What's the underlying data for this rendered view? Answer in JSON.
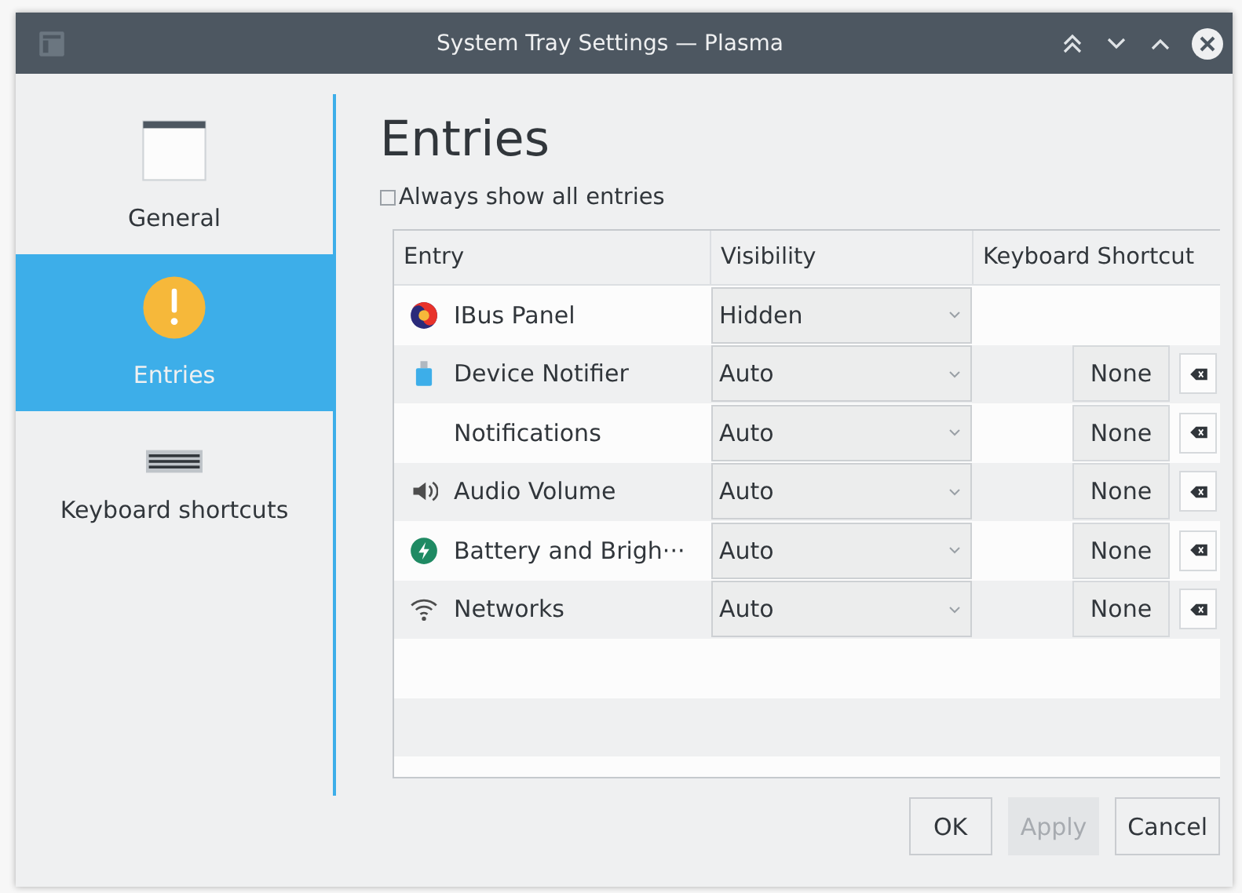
{
  "window": {
    "title": "System Tray Settings — Plasma"
  },
  "sidebar": {
    "items": [
      {
        "label": "General",
        "selected": false
      },
      {
        "label": "Entries",
        "selected": true
      },
      {
        "label": "Keyboard shortcuts",
        "selected": false
      }
    ]
  },
  "heading": "Entries",
  "always_show": {
    "label": "Always show all entries",
    "checked": false
  },
  "table": {
    "columns": [
      "Entry",
      "Visibility",
      "Keyboard Shortcut"
    ],
    "rows": [
      {
        "name": "IBus Panel",
        "visibility": "Hidden"
      },
      {
        "name": "Device Notifier",
        "visibility": "Auto",
        "shortcut": "None"
      },
      {
        "name": "Notifications",
        "visibility": "Auto",
        "shortcut": "None"
      },
      {
        "name": "Audio Volume",
        "visibility": "Auto",
        "shortcut": "None"
      },
      {
        "name": "Battery and Brigh···",
        "visibility": "Auto",
        "shortcut": "None"
      },
      {
        "name": "Networks",
        "visibility": "Auto",
        "shortcut": "None"
      }
    ]
  },
  "buttons": [
    {
      "label": "OK",
      "disabled": false
    },
    {
      "label": "Apply",
      "disabled": true
    },
    {
      "label": "Cancel",
      "disabled": false
    }
  ]
}
